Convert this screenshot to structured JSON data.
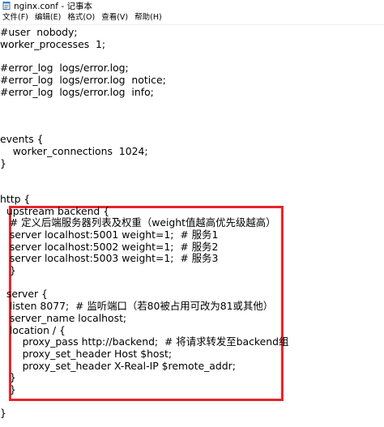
{
  "window": {
    "title": "nginx.conf - 记事本"
  },
  "icons": {
    "app": "notepad-icon"
  },
  "colors": {
    "highlight": "#e5262b",
    "text": "#000000",
    "background": "#ffffff"
  },
  "menu": {
    "items": [
      {
        "label": "文件(F)"
      },
      {
        "label": "编辑(E)"
      },
      {
        "label": "格式(O)"
      },
      {
        "label": "查看(V)"
      },
      {
        "label": "帮助(H)"
      }
    ]
  },
  "editor": {
    "lines": [
      "#user  nobody;",
      "worker_processes  1;",
      "",
      "#error_log  logs/error.log;",
      "#error_log  logs/error.log  notice;",
      "#error_log  logs/error.log  info;",
      "",
      "",
      "",
      "events {",
      "    worker_connections  1024;",
      "}",
      "",
      "",
      "http {",
      "  upstream backend {",
      "   # 定义后端服务器列表及权重（weight值越高优先级越高）",
      "   server localhost:5001 weight=1;  # 服务1",
      "   server localhost:5002 weight=1;  # 服务2",
      "   server localhost:5003 weight=1;  # 服务3",
      "   }",
      "",
      "  server {",
      "   listen 8077;  # 监听端口（若80被占用可改为81或其他）",
      "   server_name localhost;",
      "   location / {",
      "       proxy_pass http://backend;  # 将请求转发至backend组",
      "       proxy_set_header Host $host;",
      "       proxy_set_header X-Real-IP $remote_addr;",
      "   }",
      "   }",
      "",
      "}"
    ]
  }
}
